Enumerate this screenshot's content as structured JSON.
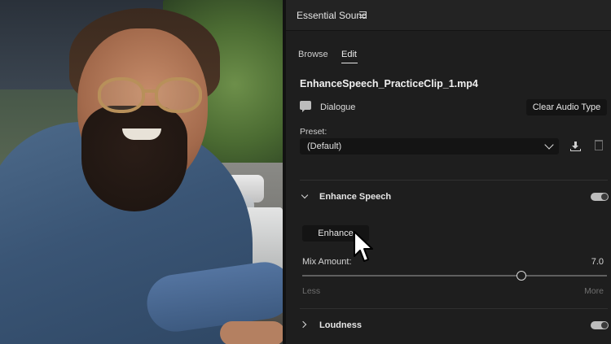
{
  "panel": {
    "title": "Essential Sound",
    "menu_icon": "hamburger-menu-icon"
  },
  "tabs": [
    {
      "label": "Browse",
      "active": false
    },
    {
      "label": "Edit",
      "active": true
    }
  ],
  "clip": {
    "name": "EnhanceSpeech_PracticeClip_1.mp4",
    "audio_type": "Dialogue",
    "audio_type_icon": "speech-bubble-icon",
    "clear_button": "Clear Audio Type"
  },
  "preset": {
    "label": "Preset:",
    "value": "(Default)",
    "save_icon": "save-preset-icon",
    "delete_icon": "trash-icon"
  },
  "enhance_speech": {
    "title": "Enhance Speech",
    "expanded": true,
    "enabled": true,
    "button": "Enhance",
    "mix_label": "Mix Amount:",
    "mix_value": "7.0",
    "mix_fraction": 0.7,
    "less": "Less",
    "more": "More"
  },
  "loudness": {
    "title": "Loudness",
    "expanded": false,
    "enabled": true
  },
  "colors": {
    "panel_bg": "#1e1e1e",
    "button_bg": "#141414",
    "text": "#e6e6e6"
  }
}
